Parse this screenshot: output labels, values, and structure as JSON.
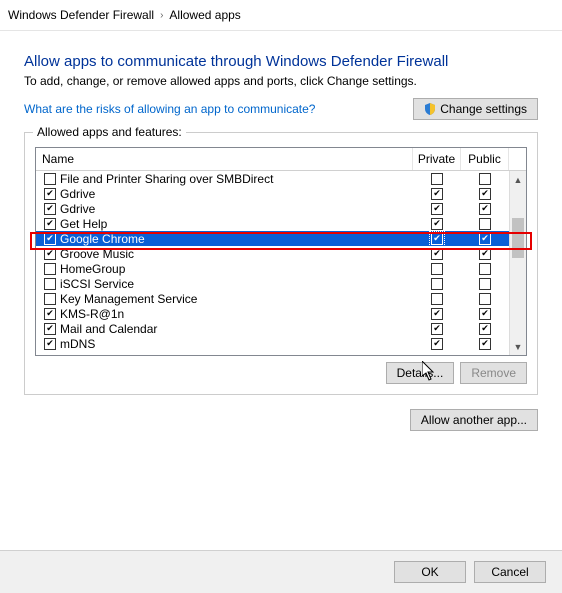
{
  "breadcrumb": {
    "root": "Windows Defender Firewall",
    "current": "Allowed apps"
  },
  "header": {
    "title": "Allow apps to communicate through Windows Defender Firewall",
    "subtitle": "To add, change, or remove allowed apps and ports, click Change settings.",
    "risks_link": "What are the risks of allowing an app to communicate?",
    "change_settings": "Change settings"
  },
  "group": {
    "label": "Allowed apps and features:",
    "columns": {
      "name": "Name",
      "private": "Private",
      "public": "Public"
    }
  },
  "rows": [
    {
      "name": "File and Printer Sharing over SMBDirect",
      "enabled": false,
      "private": false,
      "public": false,
      "selected": false
    },
    {
      "name": "Gdrive",
      "enabled": true,
      "private": true,
      "public": true,
      "selected": false
    },
    {
      "name": "Gdrive",
      "enabled": true,
      "private": true,
      "public": true,
      "selected": false
    },
    {
      "name": "Get Help",
      "enabled": true,
      "private": true,
      "public": false,
      "selected": false
    },
    {
      "name": "Google Chrome",
      "enabled": true,
      "private": true,
      "public": true,
      "selected": true
    },
    {
      "name": "Groove Music",
      "enabled": true,
      "private": true,
      "public": true,
      "selected": false
    },
    {
      "name": "HomeGroup",
      "enabled": false,
      "private": false,
      "public": false,
      "selected": false
    },
    {
      "name": "iSCSI Service",
      "enabled": false,
      "private": false,
      "public": false,
      "selected": false
    },
    {
      "name": "Key Management Service",
      "enabled": false,
      "private": false,
      "public": false,
      "selected": false
    },
    {
      "name": "KMS-R@1n",
      "enabled": true,
      "private": true,
      "public": true,
      "selected": false
    },
    {
      "name": "Mail and Calendar",
      "enabled": true,
      "private": true,
      "public": true,
      "selected": false
    },
    {
      "name": "mDNS",
      "enabled": true,
      "private": true,
      "public": true,
      "selected": false
    }
  ],
  "buttons": {
    "details": "Details...",
    "remove": "Remove",
    "allow_another": "Allow another app...",
    "ok": "OK",
    "cancel": "Cancel"
  }
}
